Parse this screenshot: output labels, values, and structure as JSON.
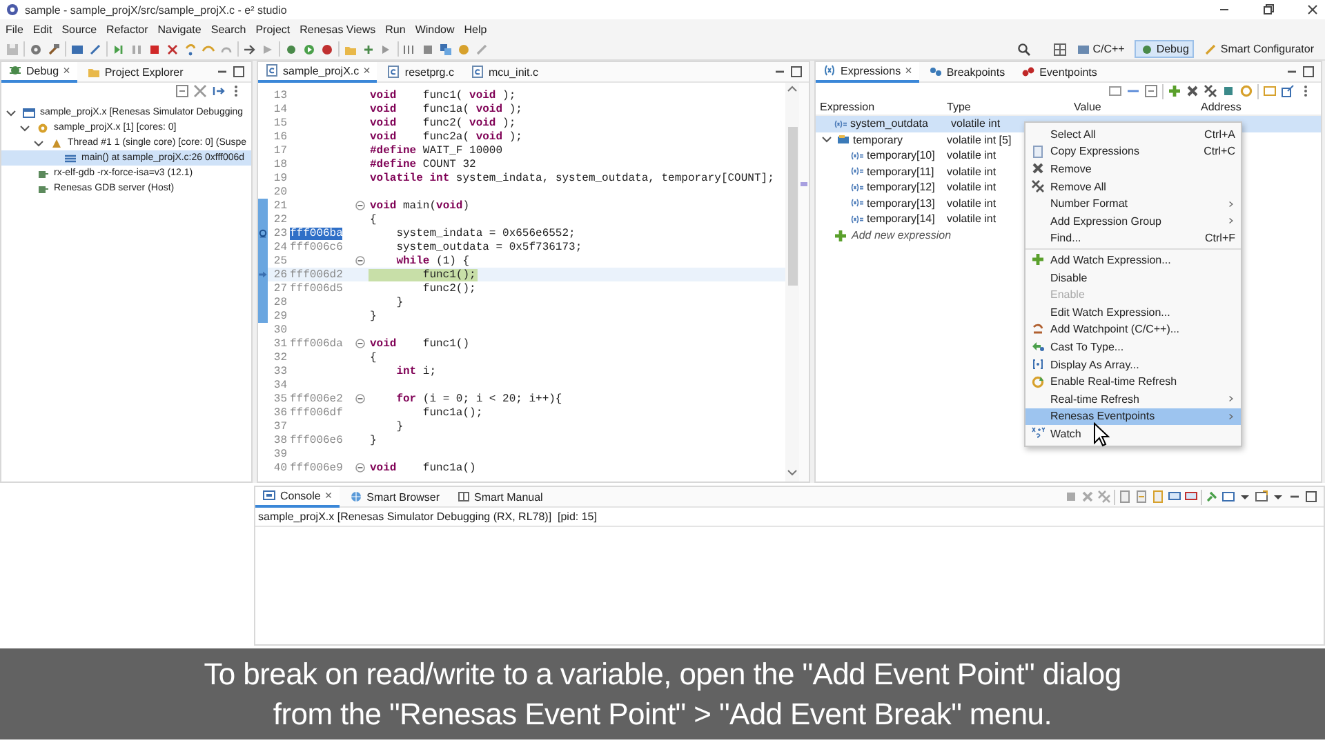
{
  "window": {
    "title": "sample - sample_projX/src/sample_projX.c - e² studio"
  },
  "menu": [
    "File",
    "Edit",
    "Source",
    "Refactor",
    "Navigate",
    "Search",
    "Project",
    "Renesas Views",
    "Run",
    "Window",
    "Help"
  ],
  "perspectives": [
    {
      "label": "C/C++",
      "selected": false
    },
    {
      "label": "Debug",
      "selected": true
    },
    {
      "label": "Smart Configurator",
      "selected": false
    }
  ],
  "debug_panel": {
    "tabs": [
      {
        "label": "Debug",
        "selected": true,
        "close": "×"
      },
      {
        "label": "Project Explorer",
        "selected": false
      }
    ],
    "tree": [
      {
        "label": "sample_projX.x [Renesas Simulator Debugging",
        "expanded": true,
        "selected": false,
        "children": [
          {
            "label": "sample_projX.x [1] [cores: 0]",
            "expanded": true,
            "selected": false,
            "children": [
              {
                "label": "Thread #1 1 (single core) [core: 0] (Suspe",
                "expanded": true,
                "selected": false,
                "children": [
                  {
                    "label": "main() at sample_projX.c:26 0xfff006d",
                    "selected": true
                  }
                ]
              }
            ]
          },
          {
            "label": "rx-elf-gdb -rx-force-isa=v3 (12.1)",
            "selected": false
          },
          {
            "label": "Renesas GDB server (Host)",
            "selected": false
          }
        ]
      }
    ]
  },
  "editor": {
    "tabs": [
      {
        "label": "sample_projX.c",
        "selected": true,
        "close": "×"
      },
      {
        "label": "resetprg.c",
        "selected": false
      },
      {
        "label": "mcu_init.c",
        "selected": false
      }
    ],
    "lines": [
      {
        "number": "13",
        "code": "**void**    func1( **void** );"
      },
      {
        "number": "14",
        "code": "**void**    func1a( **void** );"
      },
      {
        "number": "15",
        "code": "**void**    func2( **void** );"
      },
      {
        "number": "16",
        "code": "**void**    func2a( **void** );"
      },
      {
        "number": "17",
        "code": "**#define** WAIT_F 10000"
      },
      {
        "number": "18",
        "code": "**#define** COUNT 32"
      },
      {
        "number": "19",
        "code": "**volatile** **int** system_indata, system_outdata, temporary[COUNT];"
      },
      {
        "number": "20"
      },
      {
        "number": "21",
        "code": "**void** main(**void**)",
        "fold": true,
        "marked": true
      },
      {
        "number": "22",
        "code": "{",
        "marked": true
      },
      {
        "number": "23",
        "address": "fff006ba",
        "code": "    system_indata = 0x656e6552;",
        "marked": true,
        "breakpoint": true,
        "address_selected": true
      },
      {
        "number": "24",
        "address": "fff006c6",
        "code": "    system_outdata = 0x5f736173;",
        "marked": true
      },
      {
        "number": "25",
        "code": "    **while** (1) {",
        "fold": true,
        "marked": true
      },
      {
        "number": "26",
        "address": "fff006d2",
        "code": "        func1();",
        "marked": true,
        "current": true
      },
      {
        "number": "27",
        "address": "fff006d5",
        "code": "        func2();",
        "marked": true
      },
      {
        "number": "28",
        "code": "    }",
        "marked": true
      },
      {
        "number": "29",
        "code": "}",
        "marked": true
      },
      {
        "number": "30"
      },
      {
        "number": "31",
        "address": "fff006da",
        "code": "**void**    func1()",
        "fold": true
      },
      {
        "number": "32",
        "code": "{"
      },
      {
        "number": "33",
        "code": "    **int** i;"
      },
      {
        "number": "34"
      },
      {
        "number": "35",
        "address": "fff006e2",
        "code": "    **for** (i = 0; i < 20; i++){",
        "fold": true
      },
      {
        "number": "36",
        "address": "fff006df",
        "code": "        func1a();"
      },
      {
        "number": "37",
        "code": "    }"
      },
      {
        "number": "38",
        "address": "fff006e6",
        "code": "}"
      },
      {
        "number": "39"
      },
      {
        "number": "40",
        "address": "fff006e9",
        "code": "**void**    func1a()",
        "fold": true
      }
    ]
  },
  "expressions_panel": {
    "tabs": [
      {
        "label": "Expressions",
        "selected": true,
        "close": "×"
      },
      {
        "label": "Breakpoints",
        "selected": false
      },
      {
        "label": "Eventpoints",
        "selected": false
      }
    ],
    "columns": [
      "Expression",
      "Type",
      "Value",
      "Address"
    ],
    "rows": [
      {
        "name": "system_outdata",
        "type": "volatile int",
        "selected": true
      },
      {
        "name": "temporary",
        "type": "volatile int [5]",
        "expanded": true,
        "selected": false,
        "children": [
          {
            "name": "temporary[10]",
            "type": "volatile int",
            "selected": false
          },
          {
            "name": "temporary[11]",
            "type": "volatile int",
            "selected": false
          },
          {
            "name": "temporary[12]",
            "type": "volatile int",
            "selected": false
          },
          {
            "name": "temporary[13]",
            "type": "volatile int",
            "selected": false
          },
          {
            "name": "temporary[14]",
            "type": "volatile int",
            "selected": false
          }
        ]
      }
    ],
    "add_row": "Add new expression"
  },
  "context_menu": {
    "items": [
      {
        "label": "Select All",
        "shortcut": "Ctrl+A",
        "disabled": false,
        "selected": false
      },
      {
        "label": "Copy Expressions",
        "shortcut": "Ctrl+C",
        "disabled": false,
        "selected": false
      },
      {
        "label": "Remove",
        "disabled": false,
        "selected": false
      },
      {
        "label": "Remove All",
        "disabled": false,
        "selected": false
      },
      {
        "label": "Number Format",
        "submenu": true,
        "disabled": false,
        "selected": false
      },
      {
        "label": "Add Expression Group",
        "submenu": true,
        "disabled": false,
        "selected": false
      },
      {
        "label": "Find...",
        "shortcut": "Ctrl+F",
        "disabled": false,
        "selected": false
      },
      {
        "label": "Add Watch Expression...",
        "separator_before": true,
        "disabled": false,
        "selected": false
      },
      {
        "label": "Disable",
        "disabled": false,
        "selected": false
      },
      {
        "label": "Enable",
        "disabled": true,
        "selected": false
      },
      {
        "label": "Edit Watch Expression...",
        "disabled": false,
        "selected": false
      },
      {
        "label": "Add Watchpoint (C/C++)...",
        "disabled": false,
        "selected": false
      },
      {
        "label": "Cast To Type...",
        "disabled": false,
        "selected": false
      },
      {
        "label": "Display As Array...",
        "disabled": false,
        "selected": false
      },
      {
        "label": "Enable Real-time Refresh",
        "disabled": false,
        "selected": false
      },
      {
        "label": "Real-time Refresh",
        "submenu": true,
        "disabled": false,
        "selected": false
      },
      {
        "label": "Renesas Eventpoints",
        "submenu": true,
        "disabled": false,
        "selected": true
      },
      {
        "label": "Watch",
        "disabled": false,
        "selected": false
      }
    ]
  },
  "console": {
    "tabs": [
      {
        "label": "Console",
        "selected": true,
        "close": "×"
      },
      {
        "label": "Smart Browser",
        "selected": false
      },
      {
        "label": "Smart Manual",
        "selected": false
      }
    ],
    "text": "sample_projX.x [Renesas Simulator Debugging (RX, RL78)]  [pid: 15]"
  },
  "caption": [
    "To break on read/write to a variable, open the \"Add Event Point\" dialog",
    "from the \"Renesas Event Point\" > \"Add Event Break\" menu."
  ]
}
